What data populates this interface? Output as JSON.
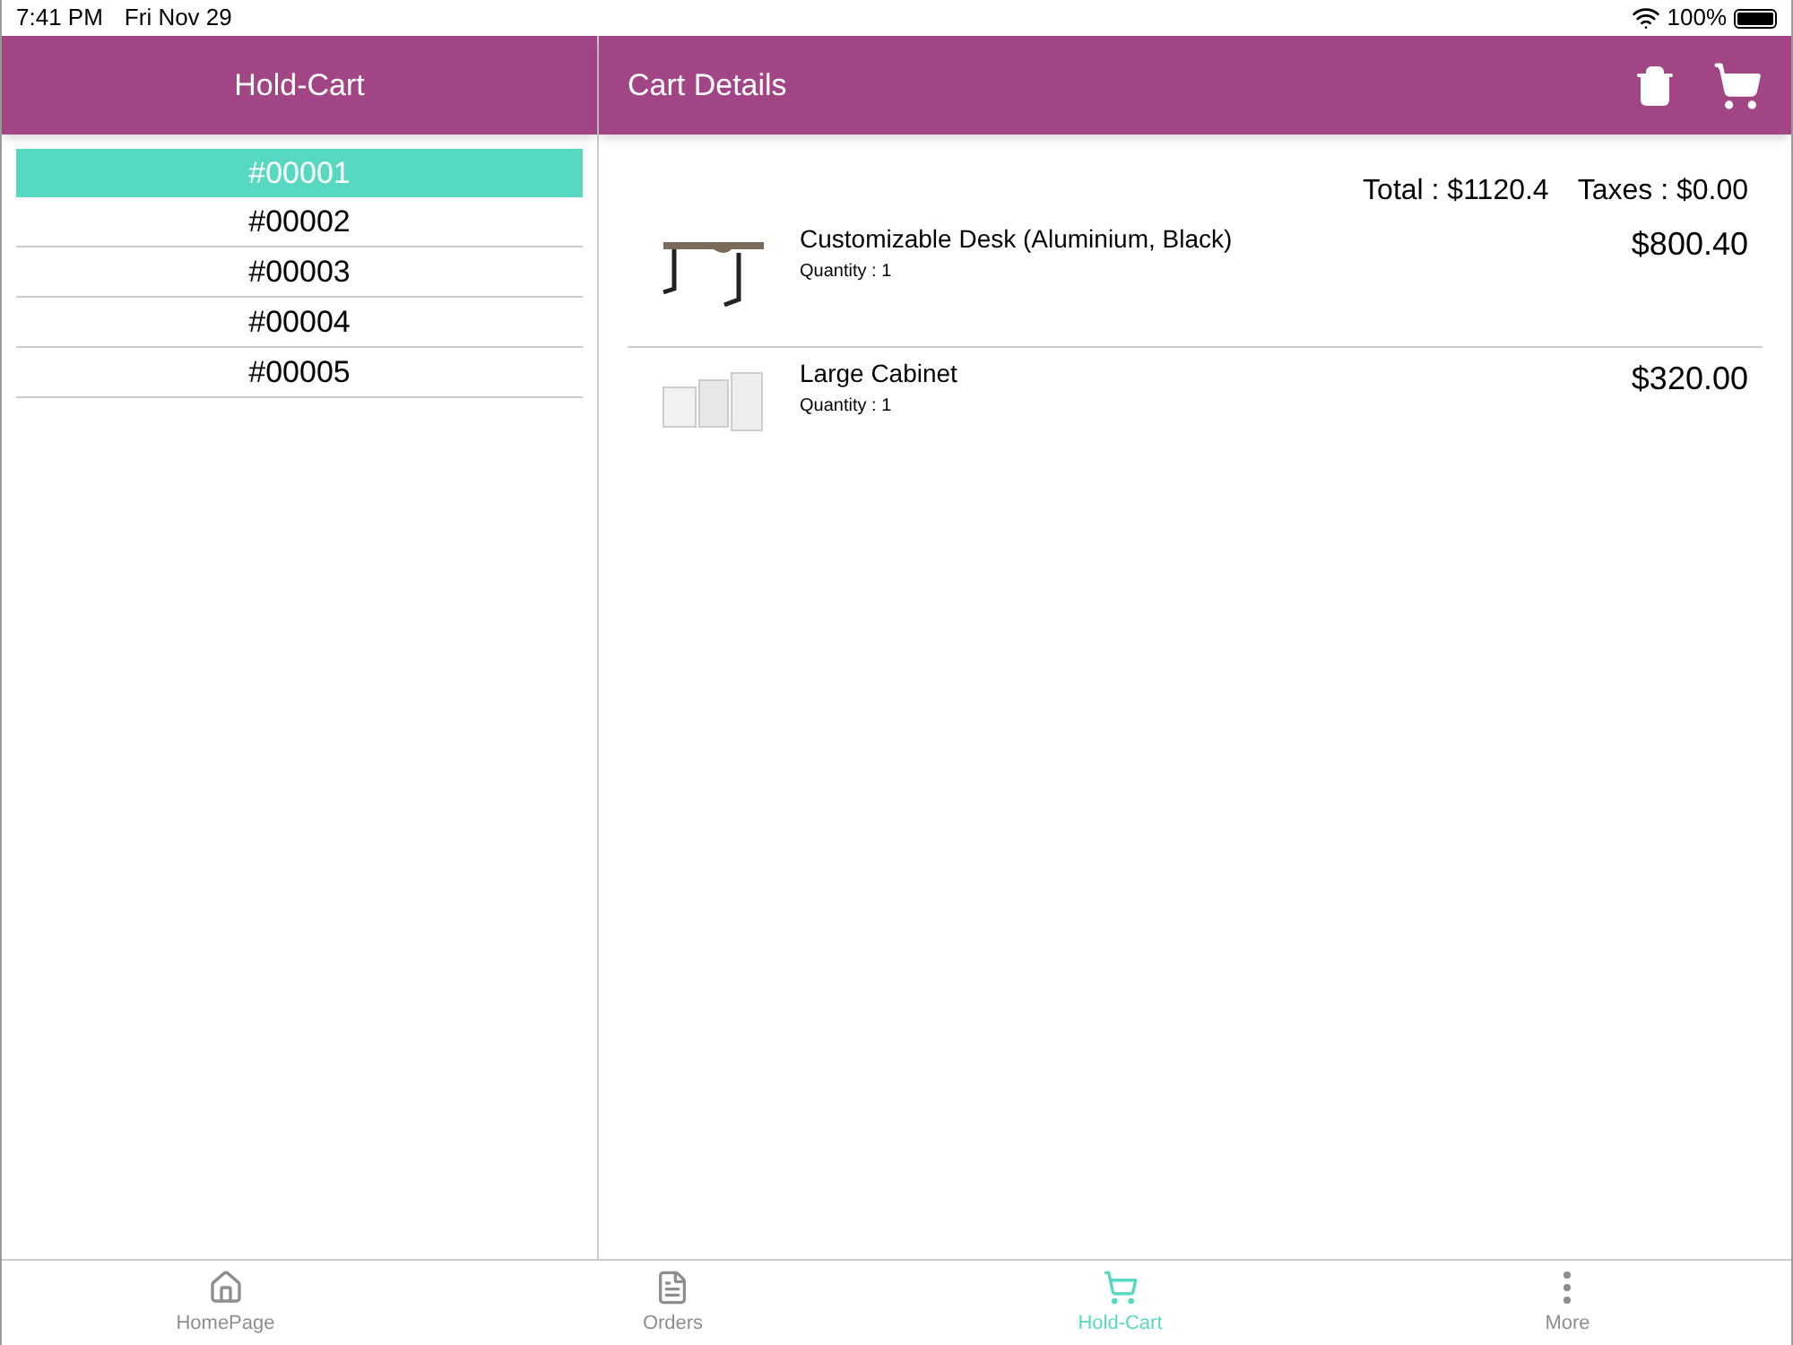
{
  "status_bar": {
    "time": "7:41 PM",
    "date": "Fri Nov 29",
    "battery": "100%"
  },
  "left_header": {
    "title": "Hold-Cart"
  },
  "carts": [
    {
      "label": "#00001",
      "selected": true
    },
    {
      "label": "#00002",
      "selected": false
    },
    {
      "label": "#00003",
      "selected": false
    },
    {
      "label": "#00004",
      "selected": false
    },
    {
      "label": "#00005",
      "selected": false
    }
  ],
  "right_header": {
    "title": "Cart Details"
  },
  "summary": {
    "total": "Total : $1120.4",
    "taxes": "Taxes : $0.00"
  },
  "items": [
    {
      "kind": "desk",
      "name": "Customizable Desk (Aluminium, Black)",
      "quantity": "Quantity : 1",
      "price": "$800.40"
    },
    {
      "kind": "cabinet",
      "name": "Large Cabinet",
      "quantity": "Quantity : 1",
      "price": "$320.00"
    }
  ],
  "tab_bar": [
    {
      "kind": "home",
      "label": "HomePage",
      "selected": false
    },
    {
      "kind": "orders",
      "label": "Orders",
      "selected": false
    },
    {
      "kind": "cart",
      "label": "Hold-Cart",
      "selected": true
    },
    {
      "kind": "more",
      "label": "More",
      "selected": false
    }
  ]
}
